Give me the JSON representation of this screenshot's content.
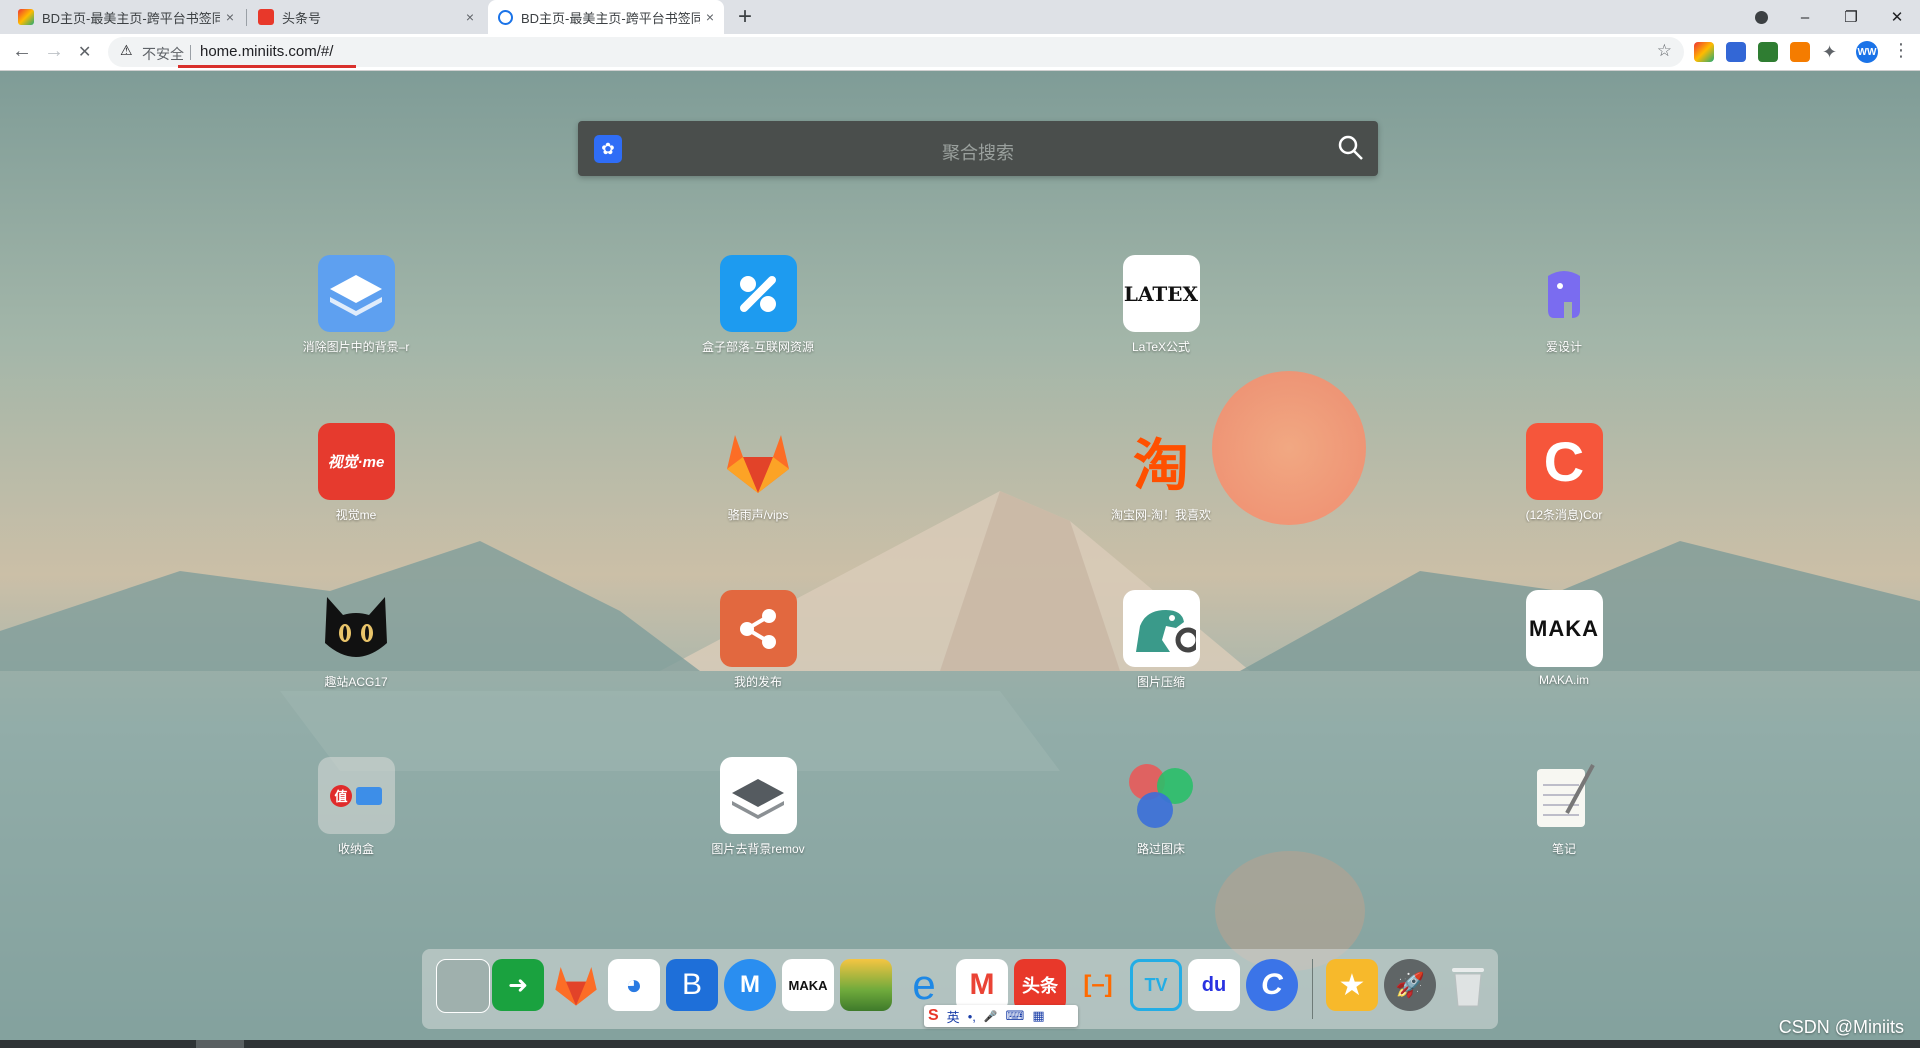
{
  "browser": {
    "tabs": [
      {
        "title": "BD主页-最美主页-跨平台书签同",
        "close": "×"
      },
      {
        "title": "头条号",
        "close": "×"
      },
      {
        "title": "BD主页-最美主页-跨平台书签同",
        "close": "×"
      }
    ],
    "new_tab": "+",
    "window": {
      "minimize": "–",
      "restore": "❐",
      "close": "✕"
    },
    "nav": {
      "back": "←",
      "forward": "→",
      "stop": "✕"
    },
    "address": {
      "warning_icon": "⚠",
      "insecure_label": "不安全",
      "url": "home.miniits.com/#/"
    },
    "bookmark_star": "☆",
    "profile": "WW",
    "menu": "⋮"
  },
  "search": {
    "placeholder": "聚合搜索",
    "engine_icon": "baidu-paw-icon"
  },
  "apps": [
    {
      "label": "消除图片中的背景–r",
      "icon": "layers-icon",
      "bg": "#5ea0f0"
    },
    {
      "label": "盒子部落-互联网资源",
      "icon": "box-tribe-icon",
      "bg": "#1d9bf0"
    },
    {
      "label": "LaTeX公式",
      "icon": "latex-icon",
      "text": "LATEX",
      "bg": "#ffffff"
    },
    {
      "label": "爱设计",
      "icon": "elephant-icon",
      "bg": "transparent"
    },
    {
      "label": "视觉me",
      "icon": "shijue-me-icon",
      "text": "视觉·me",
      "bg": "#e63a2e"
    },
    {
      "label": "骆雨声/vips",
      "icon": "gitlab-fox-icon",
      "bg": "transparent"
    },
    {
      "label": "淘宝网-淘！我喜欢",
      "icon": "taobao-icon",
      "text": "淘",
      "bg": "transparent"
    },
    {
      "label": "(12条消息)Cor",
      "icon": "csdn-c-icon",
      "text": "C",
      "bg": "#f6563b"
    },
    {
      "label": "趣站ACG17",
      "icon": "black-cat-icon",
      "bg": "transparent"
    },
    {
      "label": "我的发布",
      "icon": "share-icon",
      "bg": "#e2683f"
    },
    {
      "label": "图片压缩",
      "icon": "tinypng-dinosaur-icon",
      "bg": "#ffffff"
    },
    {
      "label": "MAKA.im",
      "icon": "maka-icon",
      "text": "MAKA",
      "bg": "#ffffff"
    },
    {
      "label": "收纳盒",
      "icon": "folder-box-icon",
      "text": "值",
      "bg": "rgba(210,215,212,0.6)"
    },
    {
      "label": "图片去背景remov",
      "icon": "remove-bg-layers-icon",
      "bg": "#ffffff"
    },
    {
      "label": "路过图床",
      "icon": "color-circles-icon",
      "bg": "transparent"
    },
    {
      "label": "笔记",
      "icon": "notepad-icon",
      "bg": "transparent"
    }
  ],
  "dock": [
    {
      "name": "broken-image-icon",
      "bg": "#9fb0ad",
      "text": ""
    },
    {
      "name": "green-file-share-icon",
      "bg": "#1aa23f",
      "text": "➜"
    },
    {
      "name": "gitlab-fox-icon",
      "bg": "transparent",
      "text": ""
    },
    {
      "name": "blue-monster-icon",
      "bg": "#ffffff",
      "text": "◕"
    },
    {
      "name": "bootstrap-b-icon",
      "bg": "#1e6fd9",
      "text": "B"
    },
    {
      "name": "messenger-m-icon",
      "bg": "#2a8ef0",
      "text": "M"
    },
    {
      "name": "maka-icon",
      "bg": "#ffffff",
      "text": "MAKA"
    },
    {
      "name": "sunrise-field-icon",
      "bg": "#6faa3c",
      "text": ""
    },
    {
      "name": "edge-icon",
      "bg": "transparent",
      "text": "e"
    },
    {
      "name": "gmail-icon",
      "bg": "#ffffff",
      "text": "M"
    },
    {
      "name": "toutiao-icon",
      "bg": "#e8382a",
      "text": "头条"
    },
    {
      "name": "alibaba-cloud-icon",
      "bg": "transparent",
      "text": "[–]"
    },
    {
      "name": "bilibili-tv-icon",
      "bg": "transparent",
      "text": "TV"
    },
    {
      "name": "baidu-paw-icon",
      "bg": "#ffffff",
      "text": "du"
    },
    {
      "name": "canva-c-icon",
      "bg": "#3b74e8",
      "text": "C"
    },
    {
      "name": "favorites-star-icon",
      "bg": "#f7b92b",
      "text": "★"
    },
    {
      "name": "launchpad-rocket-icon",
      "bg": "#5f6566",
      "text": "🚀"
    },
    {
      "name": "trash-bin-icon",
      "bg": "transparent",
      "text": ""
    }
  ],
  "ime": {
    "logo": "S",
    "lang": "英",
    "punct": "•,",
    "mic": "🎤",
    "keyboard": "⌨",
    "grid": "▦"
  },
  "watermark": "CSDN @Miniits",
  "colors": {
    "accent_underline": "#d9302c",
    "search_bg": "#4a4e4c"
  }
}
